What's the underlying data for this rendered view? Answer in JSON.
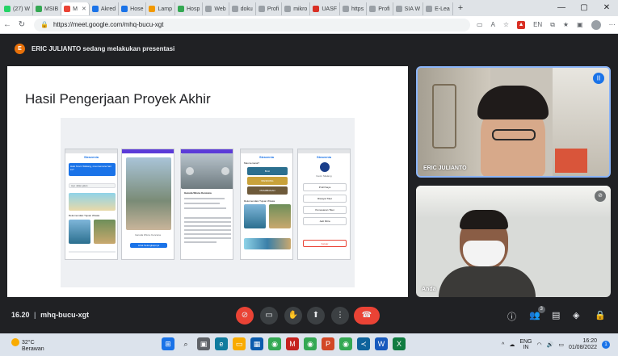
{
  "browser": {
    "tabs": [
      {
        "label": "(27) W",
        "color": "#25d366"
      },
      {
        "label": "MSIB",
        "color": "#34a853"
      },
      {
        "label": "M",
        "color": "#ea4335",
        "active": true
      },
      {
        "label": "Akred",
        "color": "#1a73e8"
      },
      {
        "label": "Hose",
        "color": "#1a73e8"
      },
      {
        "label": "Lamp",
        "color": "#f29900"
      },
      {
        "label": "Hosp",
        "color": "#34a853"
      },
      {
        "label": "Web",
        "color": "#9aa0a6"
      },
      {
        "label": "doku",
        "color": "#9aa0a6"
      },
      {
        "label": "Profi",
        "color": "#9aa0a6"
      },
      {
        "label": "mikro",
        "color": "#9aa0a6"
      },
      {
        "label": "UASF",
        "color": "#d93025"
      },
      {
        "label": "https",
        "color": "#9aa0a6"
      },
      {
        "label": "Profi",
        "color": "#9aa0a6"
      },
      {
        "label": "SIA W",
        "color": "#9aa0a6"
      },
      {
        "label": "E-Lea",
        "color": "#9aa0a6"
      }
    ],
    "new_tab": "+",
    "url": "https://meet.google.com/mhq-bucu-xgt",
    "lang_badge": "EN"
  },
  "banner": {
    "avatar_letter": "E",
    "text": "ERIC JULIANTO sedang melakukan presentasi"
  },
  "slide": {
    "title": "Hasil Pengerjaan Proyek Akhir",
    "app_name": "Stravenia",
    "phone1_banner": "Halo Kevin Silalang, mau kemana hari ini?",
    "phone1_search": "Ayo Jalan-jalan",
    "phone1_section": "Rekomendasi Tujuan Wisata",
    "phone2_caption": "Garuda Wisnu Kencana",
    "phone2_button": "Lihat Selengkapnya",
    "phone3_title": "Garuda Wisnu Kencana",
    "phone4_question": "Mau kemana?",
    "phone4_places": [
      "BALI",
      "BANDUNG",
      "PRAMBANAN"
    ],
    "phone5_user": "Kevin Silalang",
    "phone5_menu": [
      "Profil Saya",
      "Riwayat Tiket",
      "Pemesanan Tiket",
      "Jadi Mitra",
      "Keluar"
    ]
  },
  "participants": [
    {
      "name": "ERIC JULIANTO",
      "speaking": true
    },
    {
      "name": "Anda",
      "muted": true
    }
  ],
  "meetbar": {
    "time": "16.20",
    "meeting_code": "mhq-bucu-xgt",
    "people_count": "3"
  },
  "taskbar": {
    "temp": "32°C",
    "weather": "Berawan",
    "lang": "ENG",
    "lang_region": "IN",
    "time": "16:20",
    "date": "01/08/2022",
    "notif_count": "1"
  }
}
